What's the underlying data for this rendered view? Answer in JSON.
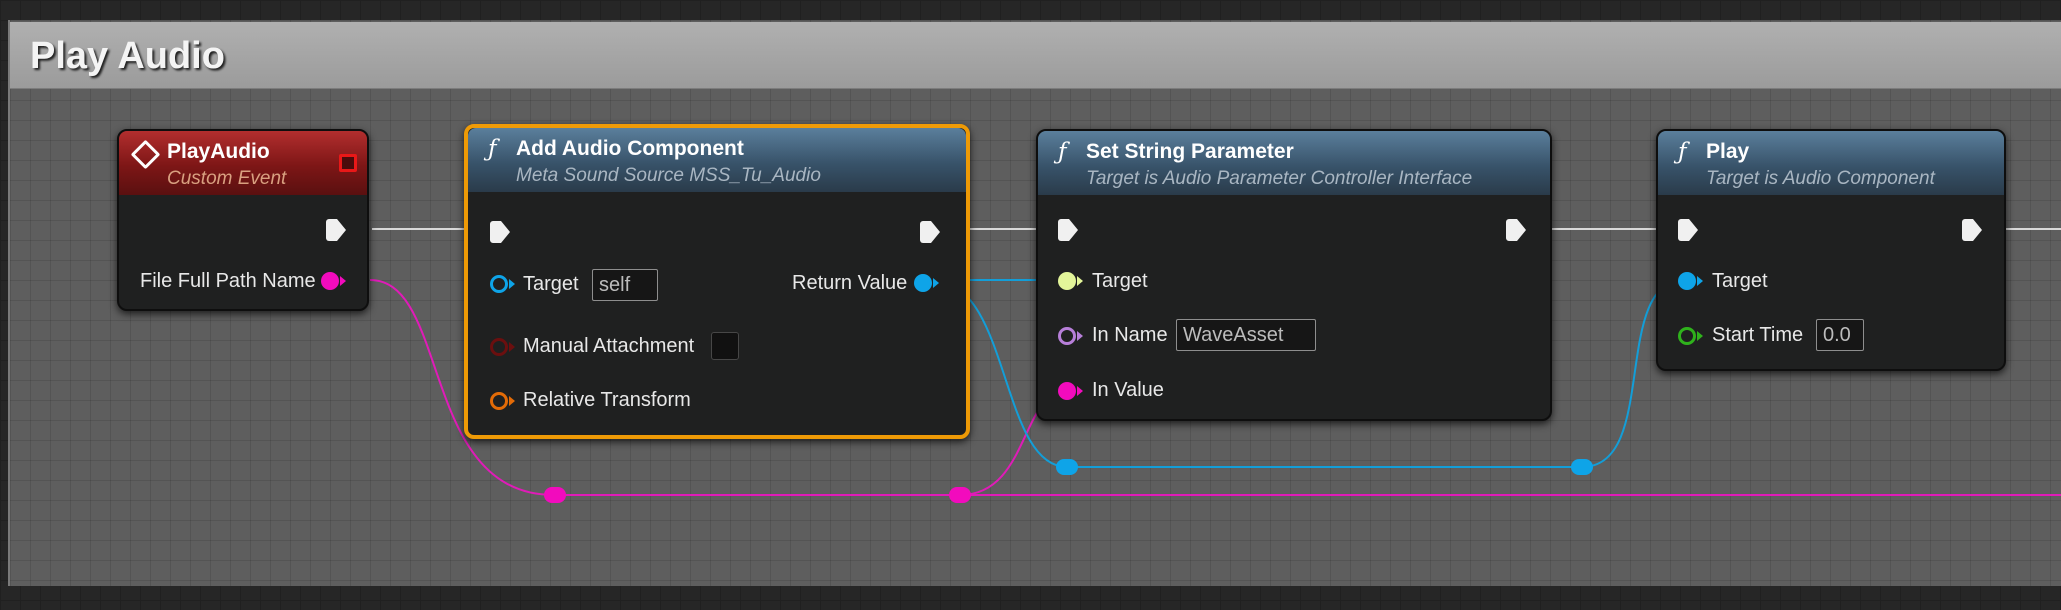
{
  "comment": {
    "title": "Play Audio"
  },
  "nodes": {
    "play_audio_event": {
      "title": "PlayAudio",
      "subtitle": "Custom Event",
      "icon": "custom-event-diamond-icon",
      "pins": {
        "file_full_path_name": "File Full Path Name"
      }
    },
    "add_audio_component": {
      "title": "Add Audio Component",
      "subtitle": "Meta Sound Source MSS_Tu_Audio",
      "icon": "function-f-icon",
      "selected": true,
      "pins": {
        "target": "Target",
        "target_value": "self",
        "manual_attachment": "Manual Attachment",
        "relative_transform": "Relative Transform",
        "return_value": "Return Value"
      }
    },
    "set_string_parameter": {
      "title": "Set String Parameter",
      "subtitle": "Target is Audio Parameter Controller Interface",
      "icon": "function-f-icon",
      "pins": {
        "target": "Target",
        "in_name": "In Name",
        "in_name_value": "WaveAsset",
        "in_value": "In Value"
      }
    },
    "play": {
      "title": "Play",
      "subtitle": "Target is Audio Component",
      "icon": "function-f-icon",
      "pins": {
        "target": "Target",
        "start_time": "Start Time",
        "start_time_value": "0.0"
      }
    }
  },
  "colors": {
    "exec": "#f0f0f0",
    "string_pin": "#f20bbd",
    "object_pin": "#0ea4e8",
    "interface_pin": "#e3f59a",
    "name_pin": "#b77fd9",
    "bool_pin": "#6b0f0f",
    "struct_pin": "#e36b07",
    "float_pin": "#2fb21c",
    "selection": "#ee9a06",
    "event_header": "#9a1f1f",
    "function_header": "#4a6a85"
  }
}
